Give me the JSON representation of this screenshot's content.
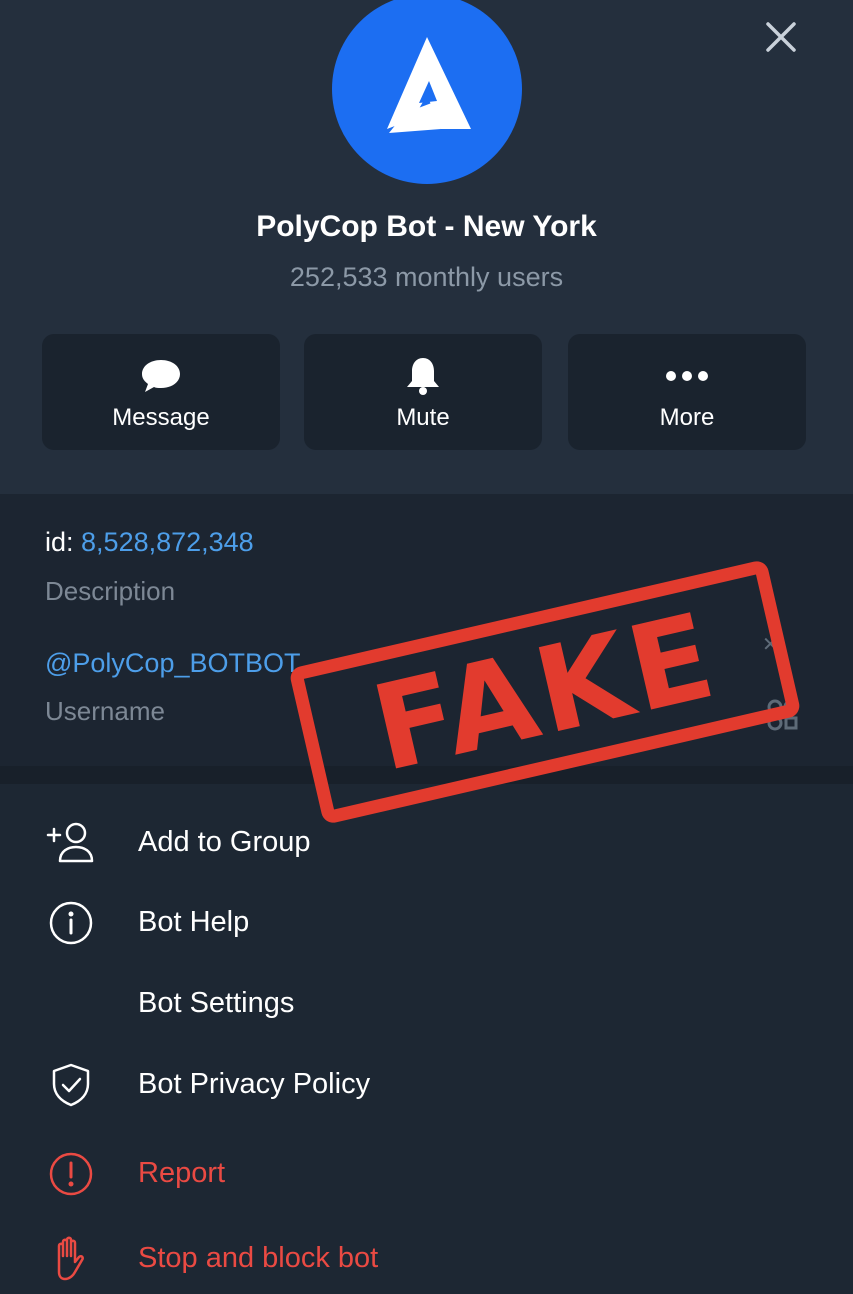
{
  "profile": {
    "name": "PolyCop Bot - New York",
    "monthly_users": "252,533 monthly users"
  },
  "actions": {
    "message": "Message",
    "mute": "Mute",
    "more": "More"
  },
  "info": {
    "id_prefix": "id: ",
    "id_value": "8,528,872,348",
    "description_label": "Description",
    "username": "@PolyCop_BOTBOT",
    "username_label": "Username"
  },
  "menu": {
    "add_to_group": "Add to Group",
    "bot_help": "Bot Help",
    "bot_settings": "Bot Settings",
    "bot_privacy_policy": "Bot Privacy Policy",
    "report": "Report",
    "stop_and_block": "Stop and block bot"
  },
  "stamp": {
    "text": "FAKE"
  },
  "colors": {
    "accent": "#4d9ee9",
    "avatar": "#1c6ef2",
    "danger": "#ea4a43",
    "stamp": "#e23b2e"
  }
}
